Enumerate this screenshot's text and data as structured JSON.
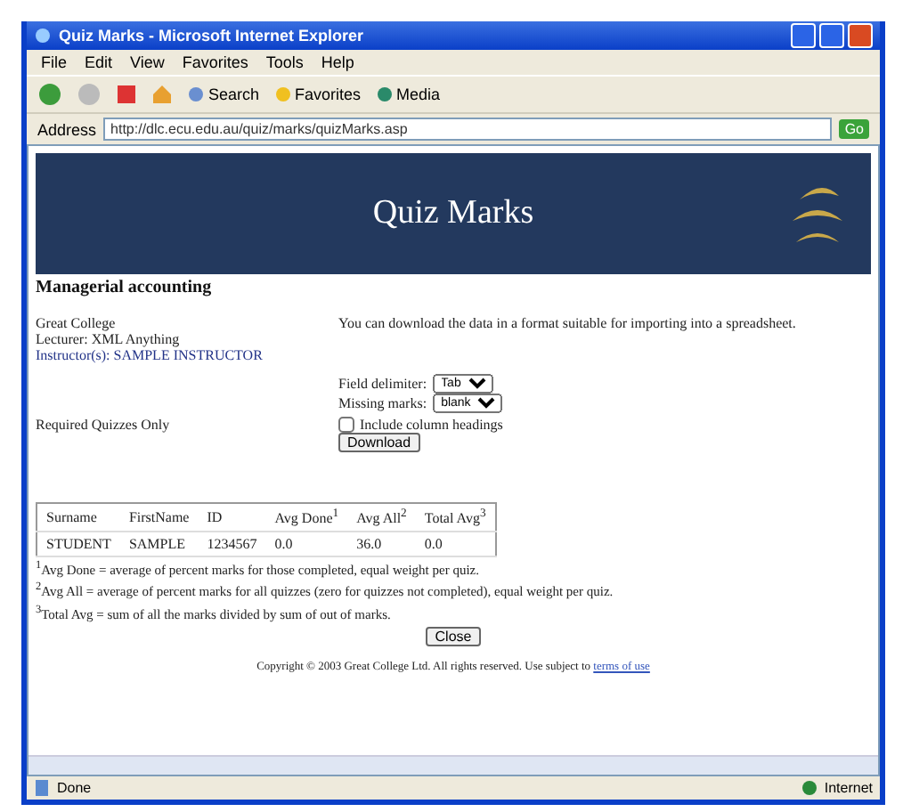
{
  "window": {
    "title": "Quiz Marks - Microsoft Internet Explorer"
  },
  "menu": [
    "File",
    "Edit",
    "View",
    "Favorites",
    "Tools",
    "Help"
  ],
  "toolbar": [
    "Search",
    "Favorites",
    "Media"
  ],
  "address": {
    "label": "Address",
    "value": "http://dlc.ecu.edu.au/quiz/marks/quizMarks.asp",
    "go": "Go"
  },
  "banner": {
    "title": "Quiz Marks"
  },
  "course": "Managerial accounting",
  "info": [
    "Great College",
    "Lecturer: XML Anything",
    "Instructor(s): SAMPLE INSTRUCTOR"
  ],
  "download_note": "You can download the data in a format suitable for importing into a spreadsheet.",
  "fields": [
    {
      "label": "Field delimiter:",
      "value": "Tab"
    },
    {
      "label": "Missing marks:",
      "value": "blank"
    }
  ],
  "include_headings": {
    "label": "Include column headings",
    "checked": false
  },
  "download_button": "Download",
  "filter": "Required Quizzes Only",
  "table": {
    "columns": [
      "Surname",
      "FirstName",
      "ID",
      "Avg Done$^{1}$",
      "Avg All$^{2}$",
      "Total Avg$^{3}$"
    ],
    "rows": [
      [
        "STUDENT",
        "SAMPLE",
        "1234567",
        "0.0",
        "36.0",
        "0.0"
      ]
    ]
  },
  "footnotes": [
    "$^{1}$Avg Done = average of percent marks for those completed, equal weight per quiz.",
    "$^{2}$Avg All = average of percent marks for all quizzes (zero for quizzes not completed), equal weight per quiz.",
    "$^{3}$Total Avg = sum of all the marks divided by sum of out of marks."
  ],
  "close_button": "Close",
  "copyright": {
    "text": "Copyright © 2003 Great College Ltd. All rights reserved. Use subject to",
    "link": "terms of use"
  },
  "status": {
    "text": "Done",
    "zone": "Internet"
  }
}
